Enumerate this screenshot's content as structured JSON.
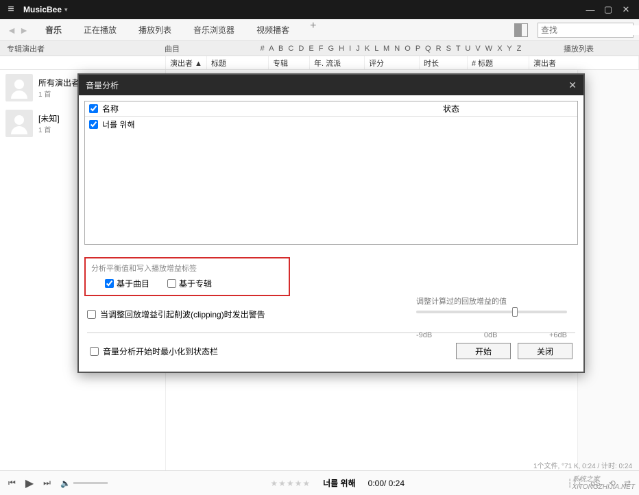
{
  "app": {
    "name": "MusicBee",
    "dropdown": "▾"
  },
  "window_controls": {
    "min": "—",
    "max": "▢",
    "close": "✕"
  },
  "toolbar": {
    "tabs": [
      "音乐",
      "正在播放",
      "播放列表",
      "音乐浏览器",
      "视频播客"
    ],
    "active_index": 0,
    "plus": "+",
    "search_placeholder": "查找"
  },
  "subheader": {
    "left": "专辑演出者",
    "mid": "曲目",
    "alpha": "# A B C D E F G H I J K L M N O P Q R S T U V W X Y Z",
    "right": "播放列表"
  },
  "columns": [
    "演出者 ▲",
    "标题",
    "专辑",
    "年. 流派",
    "评分",
    "时长",
    "#  标题",
    "演出者"
  ],
  "artists": [
    {
      "title": "所有演出者",
      "count": "1 首"
    },
    {
      "title": "[未知]",
      "count": "1 首"
    }
  ],
  "dialog": {
    "title": "音量分析",
    "list_header_name": "名称",
    "list_header_state": "状态",
    "tracks": [
      "너를 위해"
    ],
    "highlight_label": "分析平衡值和写入播放增益标签",
    "opt_track": "基于曲目",
    "opt_album": "基于专辑",
    "slider_label": "调整计算过的回放增益的值",
    "slider_ticks": [
      "-9dB",
      "0dB",
      "+6dB"
    ],
    "clip_warn": "当调整回放增益引起削波(clipping)时发出警告",
    "minimize_label": "音量分析开始时最小化到状态栏",
    "btn_start": "开始",
    "btn_close": "关闭"
  },
  "status": "1个文件, °71 K, 0:24 /   计时: 0:24",
  "player": {
    "stars": "★★★★★",
    "song": "너를 위해",
    "time": "0:00/ 0:24"
  },
  "watermark": "系统之家\nXITONGZHIJIA.NET"
}
